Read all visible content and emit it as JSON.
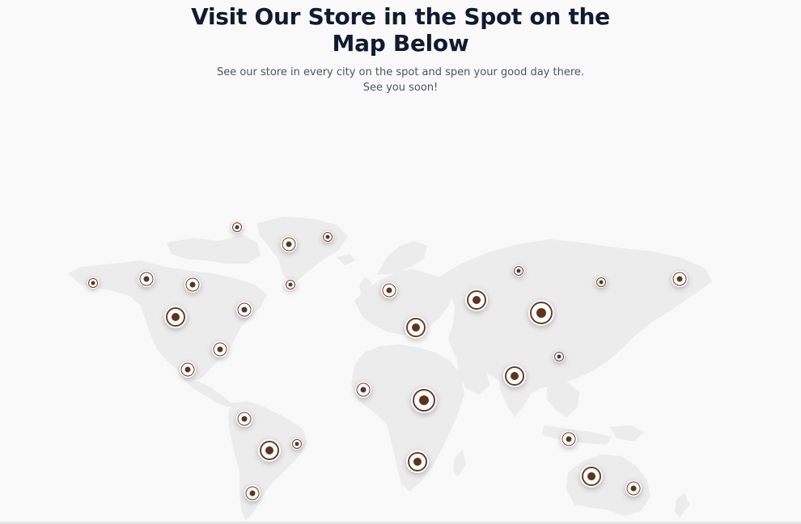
{
  "section": {
    "title": "Visit Our Store in the Spot on the Map Below",
    "subtitle": "See our store in every city on the spot and spen your good day there. See you soon!"
  },
  "map": {
    "land_color": "#ececed",
    "pin_color": "#5e3320",
    "pin_icon": "location-target-icon",
    "store_pins": [
      {
        "region": "alaska",
        "size": "s"
      },
      {
        "region": "northwest-canada",
        "size": "m"
      },
      {
        "region": "hudson-bay",
        "size": "m"
      },
      {
        "region": "arctic-canada",
        "size": "s"
      },
      {
        "region": "greenland-west",
        "size": "m"
      },
      {
        "region": "greenland-east",
        "size": "s"
      },
      {
        "region": "greenland-south",
        "size": "s"
      },
      {
        "region": "western-usa",
        "size": "l"
      },
      {
        "region": "eastern-canada",
        "size": "m"
      },
      {
        "region": "eastern-usa",
        "size": "m"
      },
      {
        "region": "mexico",
        "size": "m"
      },
      {
        "region": "colombia",
        "size": "m"
      },
      {
        "region": "brazil",
        "size": "l"
      },
      {
        "region": "eastern-brazil",
        "size": "s"
      },
      {
        "region": "argentina",
        "size": "m"
      },
      {
        "region": "scandinavia",
        "size": "m"
      },
      {
        "region": "central-europe",
        "size": "l"
      },
      {
        "region": "west-africa",
        "size": "m"
      },
      {
        "region": "central-africa",
        "size": "xl"
      },
      {
        "region": "southern-africa",
        "size": "l"
      },
      {
        "region": "western-russia",
        "size": "l"
      },
      {
        "region": "siberia",
        "size": "xl"
      },
      {
        "region": "arctic-russia",
        "size": "s"
      },
      {
        "region": "eastern-siberia",
        "size": "s"
      },
      {
        "region": "far-east-russia",
        "size": "m"
      },
      {
        "region": "china",
        "size": "s"
      },
      {
        "region": "india",
        "size": "l"
      },
      {
        "region": "indonesia",
        "size": "m"
      },
      {
        "region": "western-australia",
        "size": "l"
      },
      {
        "region": "eastern-australia",
        "size": "m"
      }
    ]
  }
}
